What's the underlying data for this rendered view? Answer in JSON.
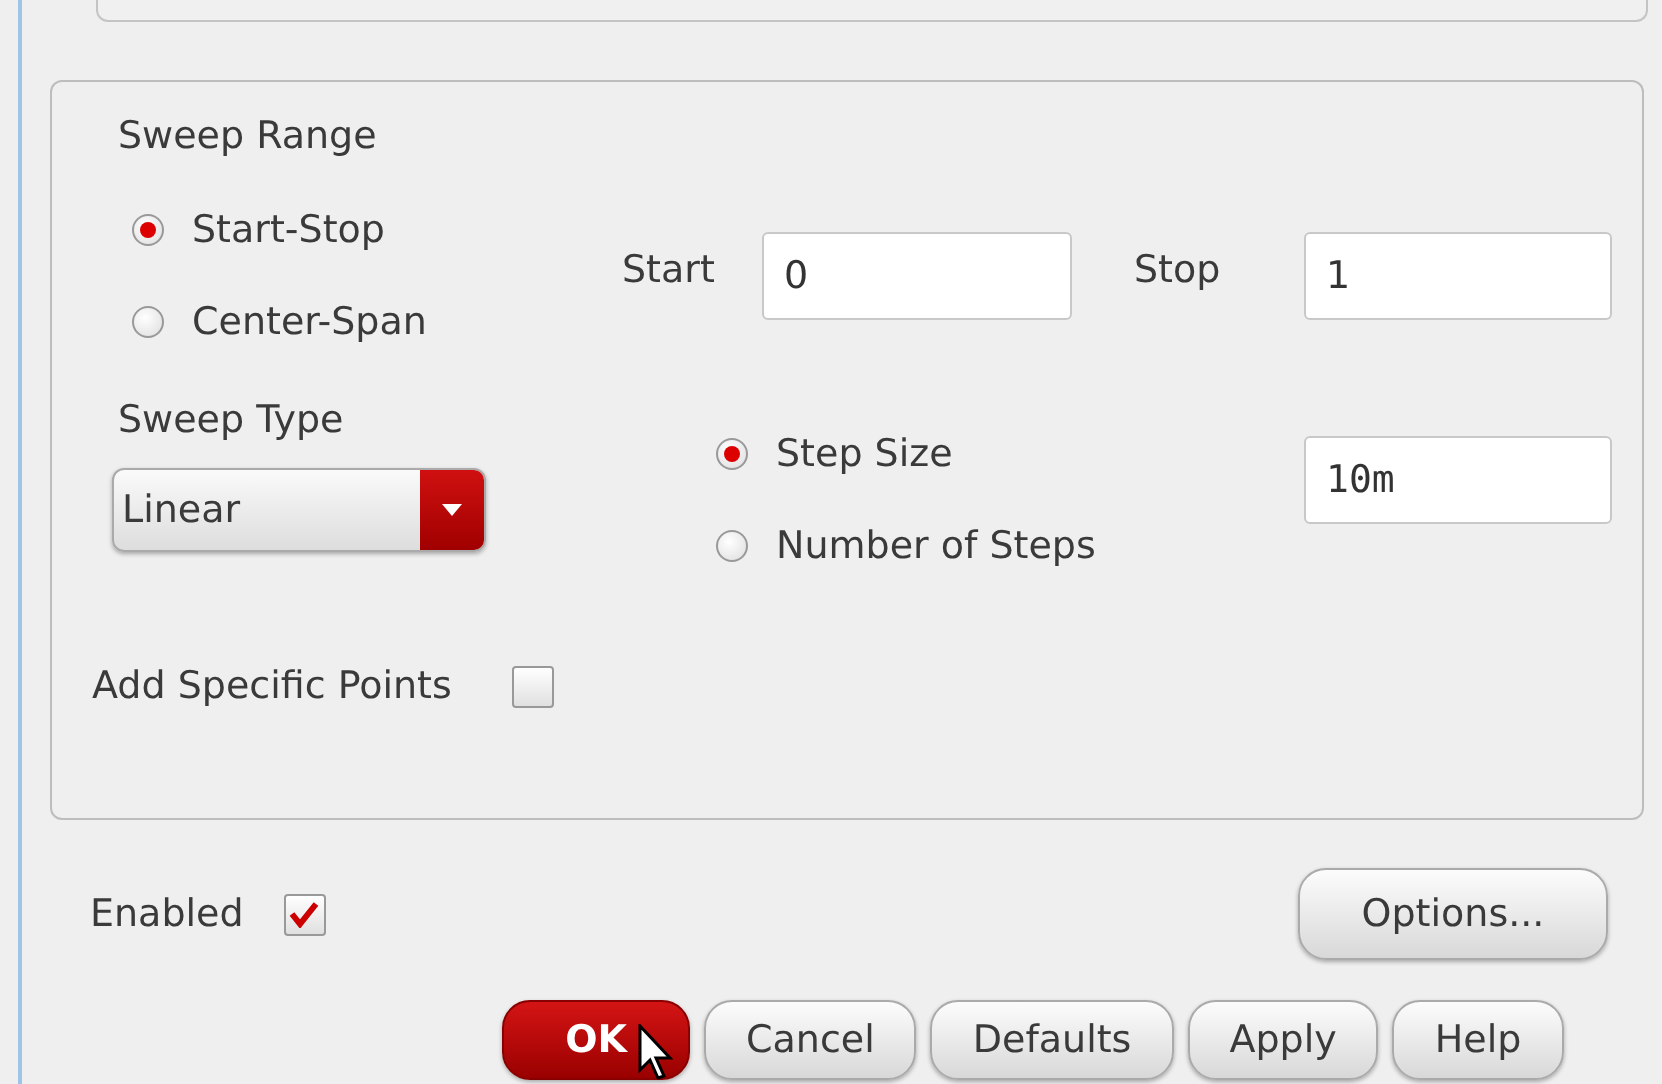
{
  "sweep_range": {
    "label": "Sweep Range",
    "options": [
      {
        "label": "Start-Stop",
        "selected": true
      },
      {
        "label": "Center-Span",
        "selected": false
      }
    ],
    "start": {
      "label": "Start",
      "value": "0"
    },
    "stop": {
      "label": "Stop",
      "value": "1"
    }
  },
  "sweep_type": {
    "label": "Sweep Type",
    "value": "Linear",
    "step_options": [
      {
        "label": "Step Size",
        "selected": true
      },
      {
        "label": "Number of Steps",
        "selected": false
      }
    ],
    "step_value": "10m"
  },
  "add_specific_points": {
    "label": "Add Specific Points",
    "checked": false
  },
  "enabled": {
    "label": "Enabled",
    "checked": true
  },
  "options_button": "Options...",
  "buttons": [
    {
      "label": "OK",
      "kind": "primary"
    },
    {
      "label": "Cancel",
      "kind": "normal"
    },
    {
      "label": "Defaults",
      "kind": "normal"
    },
    {
      "label": "Apply",
      "kind": "normal"
    },
    {
      "label": "Help",
      "kind": "normal"
    }
  ]
}
